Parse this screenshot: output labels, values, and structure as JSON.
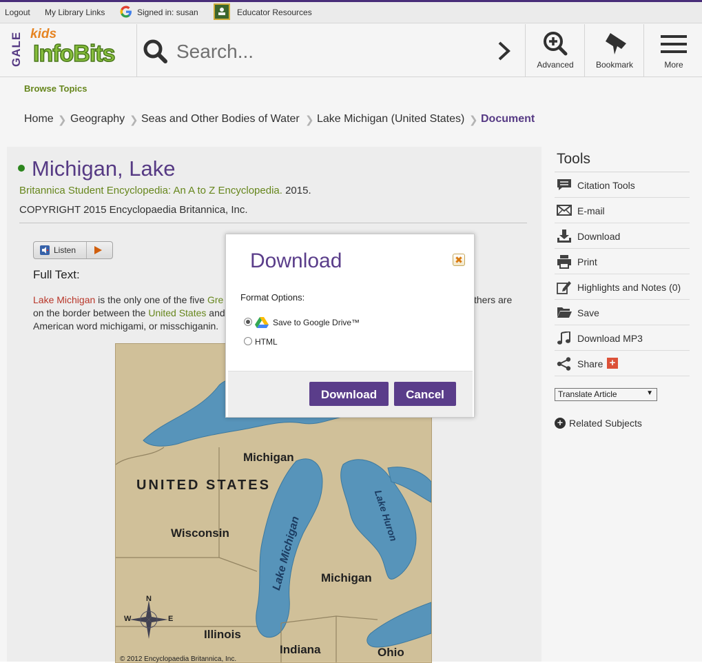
{
  "topbar": {
    "logout": "Logout",
    "my_library_links": "My Library Links",
    "signed_in": "Signed in: susan",
    "educator_resources": "Educator Resources"
  },
  "header": {
    "brand_gale": "GALE",
    "brand_kids": "kids",
    "brand_name": "InfoBits",
    "search_placeholder": "Search...",
    "buttons": [
      {
        "label": "Advanced",
        "icon": "zoom-plus-icon"
      },
      {
        "label": "Bookmark",
        "icon": "bookmark-icon"
      },
      {
        "label": "More",
        "icon": "hamburger-menu-icon"
      }
    ]
  },
  "browse_topics": "Browse Topics",
  "breadcrumb": [
    "Home",
    "Geography",
    "Seas and Other Bodies of Water",
    "Lake Michigan (United States)",
    "Document"
  ],
  "document": {
    "title": "Michigan, Lake",
    "source_link": "Britannica Student Encyclopedia: An A to Z Encyclopedia.",
    "source_year": " 2015.",
    "copyright": "COPYRIGHT 2015 Encyclopaedia Britannica, Inc.",
    "listen_label": "Listen",
    "full_text_heading": "Full Text:",
    "para_line1": {
      "link": "Lake Michigan",
      "text1": " is the only one of the five ",
      "link2": "Gre",
      "tail": "thers are"
    },
    "para_line2": {
      "text": "on the border between the ",
      "link": "United States",
      "text2": " and"
    },
    "para_line3": "American word michigami, or misschiganin.",
    "map_labels": {
      "michigan_top": "Michigan",
      "united_states": "UNITED STATES",
      "wisconsin": "Wisconsin",
      "lake_michigan": "Lake Michigan",
      "lake_huron": "Lake Huron",
      "michigan_lower": "Michigan",
      "illinois": "Illinois",
      "indiana": "Indiana",
      "ohio": "Ohio",
      "credit": "© 2012 Encyclopaedia Britannica, Inc.",
      "compass_n": "N",
      "compass_w": "W",
      "compass_e": "E"
    }
  },
  "tools": {
    "title": "Tools",
    "items": [
      {
        "label": "Citation Tools",
        "icon": "speech-bubble-icon"
      },
      {
        "label": "E-mail",
        "icon": "envelope-icon"
      },
      {
        "label": "Download",
        "icon": "download-icon"
      },
      {
        "label": "Print",
        "icon": "printer-icon"
      },
      {
        "label": "Highlights and Notes (0)",
        "icon": "pencil-note-icon"
      },
      {
        "label": "Save",
        "icon": "folder-icon"
      },
      {
        "label": "Download MP3",
        "icon": "music-note-icon"
      },
      {
        "label": "Share",
        "icon": "share-icon"
      }
    ],
    "translate": "Translate Article",
    "related": "Related Subjects"
  },
  "modal": {
    "title": "Download",
    "close": "✖",
    "format_label": "Format Options:",
    "options": [
      {
        "label": "Save to Google Drive™",
        "selected": true
      },
      {
        "label": "HTML",
        "selected": false
      }
    ],
    "download_button": "Download",
    "cancel_button": "Cancel"
  },
  "colors": {
    "brand_purple": "#5a3d8a",
    "brand_green": "#6b8c1e",
    "lake_blue": "#5b9bc2",
    "land_tan": "#d9c8a0"
  }
}
